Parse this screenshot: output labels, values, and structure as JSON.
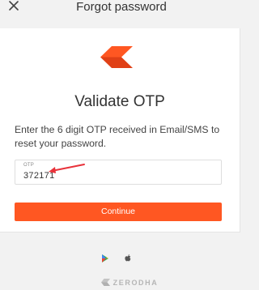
{
  "header": {
    "title": "Forgot password",
    "close_icon": "close-icon"
  },
  "card": {
    "logo_icon": "brand-logo",
    "title": "Validate OTP",
    "description": "Enter the 6 digit OTP received in Email/SMS to reset your password.",
    "otp_field": {
      "label": "OTP",
      "value": "372171"
    },
    "continue_label": "Continue"
  },
  "footer": {
    "store_icons": [
      "google-play-icon",
      "apple-icon"
    ],
    "brand_text": "ZERODHA"
  },
  "colors": {
    "accent": "#ff5722",
    "annotation_arrow": "#e8323a",
    "page_bg": "#f2f2f2",
    "card_bg": "#ffffff"
  }
}
